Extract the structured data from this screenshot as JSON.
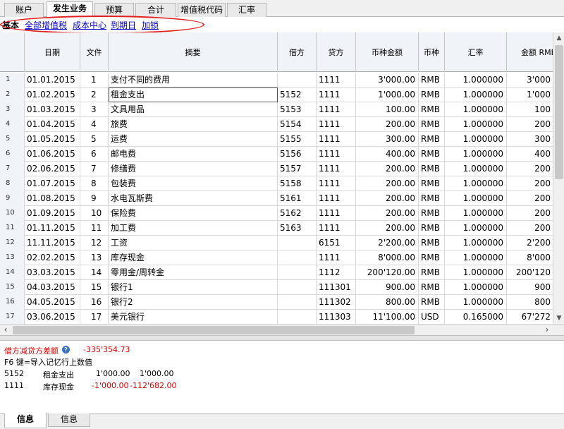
{
  "top_tabs": [
    {
      "label": "账户",
      "active": false
    },
    {
      "label": "发生业务",
      "active": true
    },
    {
      "label": "预算",
      "active": false
    },
    {
      "label": "合计",
      "active": false
    },
    {
      "label": "增值税代码",
      "active": false
    },
    {
      "label": "汇率",
      "active": false
    }
  ],
  "view_bar": {
    "current": "基本",
    "links": [
      "全部增值税",
      "成本中心",
      "到期日",
      "加锁"
    ]
  },
  "columns": [
    "",
    "日期",
    "文件",
    "摘要",
    "借方",
    "贷方",
    "币种金额",
    "币种",
    "汇率",
    "金额 RMB"
  ],
  "rows": [
    {
      "n": "1",
      "date": "01.01.2015",
      "doc": "1",
      "desc": "支付不同的费用",
      "debit": "",
      "credit": "1111",
      "amt": "3'000.00",
      "cur": "RMB",
      "rate": "1.000000",
      "rmb": "3'000"
    },
    {
      "n": "2",
      "date": "01.02.2015",
      "doc": "2",
      "desc": "租金支出",
      "debit": "5152",
      "credit": "1111",
      "amt": "1'000.00",
      "cur": "RMB",
      "rate": "1.000000",
      "rmb": "1'000"
    },
    {
      "n": "3",
      "date": "01.03.2015",
      "doc": "3",
      "desc": "文具用品",
      "debit": "5153",
      "credit": "1111",
      "amt": "100.00",
      "cur": "RMB",
      "rate": "1.000000",
      "rmb": "100"
    },
    {
      "n": "4",
      "date": "01.04.2015",
      "doc": "4",
      "desc": "旅费",
      "debit": "5154",
      "credit": "1111",
      "amt": "200.00",
      "cur": "RMB",
      "rate": "1.000000",
      "rmb": "200"
    },
    {
      "n": "5",
      "date": "01.05.2015",
      "doc": "5",
      "desc": "运费",
      "debit": "5155",
      "credit": "1111",
      "amt": "300.00",
      "cur": "RMB",
      "rate": "1.000000",
      "rmb": "300"
    },
    {
      "n": "6",
      "date": "01.06.2015",
      "doc": "6",
      "desc": "邮电费",
      "debit": "5156",
      "credit": "1111",
      "amt": "400.00",
      "cur": "RMB",
      "rate": "1.000000",
      "rmb": "400"
    },
    {
      "n": "7",
      "date": "02.06.2015",
      "doc": "7",
      "desc": "修缮费",
      "debit": "5157",
      "credit": "1111",
      "amt": "200.00",
      "cur": "RMB",
      "rate": "1.000000",
      "rmb": "200"
    },
    {
      "n": "8",
      "date": "01.07.2015",
      "doc": "8",
      "desc": "包装费",
      "debit": "5158",
      "credit": "1111",
      "amt": "200.00",
      "cur": "RMB",
      "rate": "1.000000",
      "rmb": "200"
    },
    {
      "n": "9",
      "date": "01.08.2015",
      "doc": "9",
      "desc": "水电瓦斯费",
      "debit": "5161",
      "credit": "1111",
      "amt": "200.00",
      "cur": "RMB",
      "rate": "1.000000",
      "rmb": "200"
    },
    {
      "n": "10",
      "date": "01.09.2015",
      "doc": "10",
      "desc": "保险费",
      "debit": "5162",
      "credit": "1111",
      "amt": "200.00",
      "cur": "RMB",
      "rate": "1.000000",
      "rmb": "200"
    },
    {
      "n": "11",
      "date": "01.11.2015",
      "doc": "11",
      "desc": "加工费",
      "debit": "5163",
      "credit": "1111",
      "amt": "200.00",
      "cur": "RMB",
      "rate": "1.000000",
      "rmb": "200"
    },
    {
      "n": "12",
      "date": "11.11.2015",
      "doc": "12",
      "desc": "工资",
      "debit": "",
      "credit": "6151",
      "amt": "2'200.00",
      "cur": "RMB",
      "rate": "1.000000",
      "rmb": "2'200"
    },
    {
      "n": "13",
      "date": "02.02.2015",
      "doc": "13",
      "desc": "库存现金",
      "debit": "",
      "credit": "1111",
      "amt": "8'000.00",
      "cur": "RMB",
      "rate": "1.000000",
      "rmb": "8'000"
    },
    {
      "n": "14",
      "date": "03.03.2015",
      "doc": "14",
      "desc": "零用金/周转金",
      "debit": "",
      "credit": "1112",
      "amt": "200'120.00",
      "cur": "RMB",
      "rate": "1.000000",
      "rmb": "200'120"
    },
    {
      "n": "15",
      "date": "04.03.2015",
      "doc": "15",
      "desc": "银行1",
      "debit": "",
      "credit": "111301",
      "amt": "900.00",
      "cur": "RMB",
      "rate": "1.000000",
      "rmb": "900"
    },
    {
      "n": "16",
      "date": "04.05.2015",
      "doc": "16",
      "desc": "银行2",
      "debit": "",
      "credit": "111302",
      "amt": "800.00",
      "cur": "RMB",
      "rate": "1.000000",
      "rmb": "800"
    },
    {
      "n": "17",
      "date": "03.06.2015",
      "doc": "17",
      "desc": "美元银行",
      "debit": "",
      "credit": "111303",
      "amt": "11'100.00",
      "cur": "USD",
      "rate": "0.165000",
      "rmb": "67'272"
    }
  ],
  "info": {
    "diff_label": "借方减贷方差额",
    "diff_value": "-335'354.73",
    "f6_hint": "F6 键=导入记忆行上数值",
    "lines": [
      {
        "account": "5152",
        "name": "租金支出",
        "v1": "1'000.00",
        "v2": "1'000.00",
        "red": false
      },
      {
        "account": "1111",
        "name": "库存现金",
        "v1": "-1'000.00",
        "v2": "-112'682.00",
        "red": true
      }
    ]
  },
  "bottom_tabs": [
    {
      "label": "信息",
      "active": true
    },
    {
      "label": "信息",
      "active": false
    }
  ],
  "colors": {
    "accent_red": "#e00000",
    "link": "#0000cc",
    "header_bg": "#f0f3f8"
  },
  "icons": {
    "help": "help-icon",
    "scroll_left": "arrow-left-icon",
    "scroll_right": "arrow-right-icon",
    "scroll_up": "arrow-up-icon",
    "scroll_down": "arrow-down-icon"
  }
}
